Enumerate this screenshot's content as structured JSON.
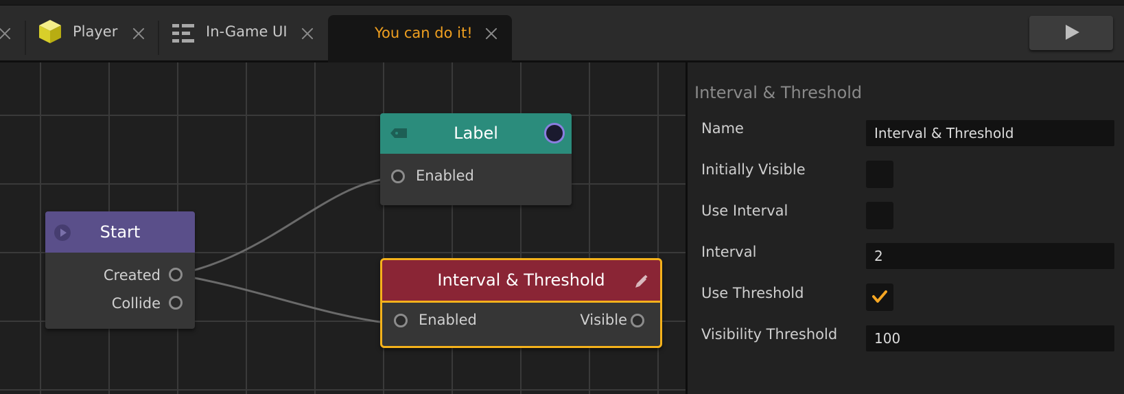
{
  "tabs": [
    {
      "label": "Player",
      "icon": "yellow-cube-icon",
      "active": false
    },
    {
      "label": "In-Game UI",
      "icon": "ui-layout-icon",
      "active": false
    },
    {
      "label": "You can do it!",
      "icon": "",
      "active": true
    }
  ],
  "toolbar": {
    "play_icon": "play-icon"
  },
  "colors": {
    "active_tab_text": "#f0a020",
    "start_header": "#5a4f8a",
    "label_header": "#2b8c7c",
    "interval_header": "#8a2535",
    "selection_outline": "#f5b21b",
    "checkmark": "#f5a623"
  },
  "graph": {
    "start_node": {
      "title": "Start",
      "ports": [
        "Created",
        "Collide"
      ]
    },
    "label_node": {
      "title": "Label",
      "input": "Enabled"
    },
    "interval_node": {
      "title": "Interval & Threshold",
      "input": "Enabled",
      "output": "Visible",
      "selected": true
    }
  },
  "properties": {
    "title": "Interval & Threshold",
    "name_label": "Name",
    "name_value": "Interval & Threshold",
    "initially_visible_label": "Initially Visible",
    "initially_visible": false,
    "use_interval_label": "Use Interval",
    "use_interval": false,
    "interval_label": "Interval",
    "interval_value": "2",
    "use_threshold_label": "Use Threshold",
    "use_threshold": true,
    "visibility_threshold_label": "Visibility Threshold",
    "visibility_threshold_value": "100"
  }
}
